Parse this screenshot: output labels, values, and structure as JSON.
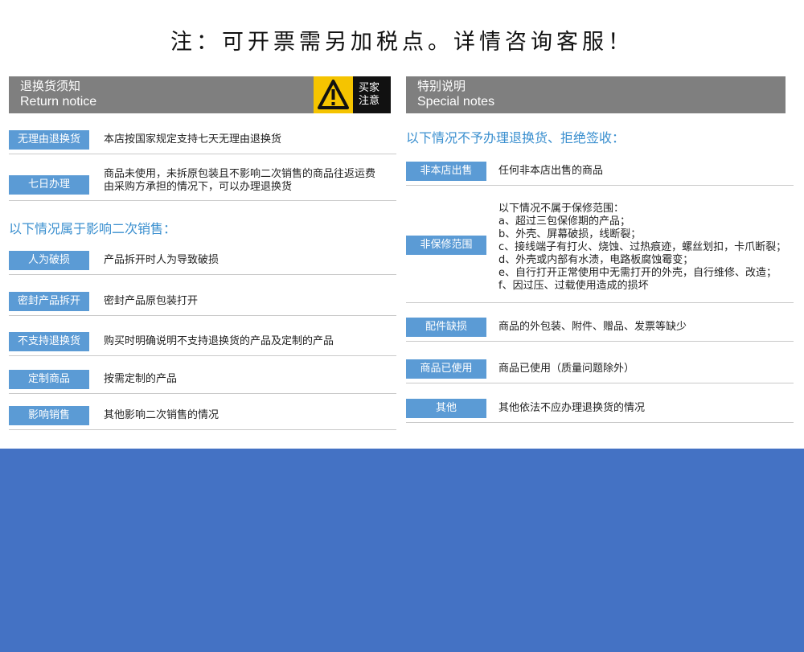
{
  "top_notice": "注：可开票需另加税点。详情咨询客服！",
  "left": {
    "header_cn": "退换货须知",
    "header_en": "Return notice",
    "warning_line1": "买家",
    "warning_line2": "注意",
    "rows_top": [
      {
        "tag": "无理由退换货",
        "lines": [
          "本店按国家规定支持七天无理由退换货"
        ]
      },
      {
        "tag": "七日办理",
        "lines": [
          "商品未使用，未拆原包装且不影响二次销售的商品往返运费",
          "由采购方承担的情况下，可以办理退换货"
        ]
      }
    ],
    "subheading": "以下情况属于影响二次销售：",
    "rows_bottom": [
      {
        "tag": "人为破损",
        "lines": [
          "产品拆开时人为导致破损"
        ]
      },
      {
        "tag": "密封产品拆开",
        "lines": [
          "密封产品原包装打开"
        ]
      },
      {
        "tag": "不支持退换货",
        "lines": [
          "购买时明确说明不支持退换货的产品及定制的产品"
        ]
      },
      {
        "tag": "定制商品",
        "lines": [
          "按需定制的产品"
        ]
      },
      {
        "tag": "影响销售",
        "lines": [
          "其他影响二次销售的情况"
        ]
      }
    ]
  },
  "right": {
    "header_cn": "特别说明",
    "header_en": "Special notes",
    "subheading": "以下情况不予办理退换货、拒绝签收：",
    "rows": [
      {
        "tag": "非本店出售",
        "lines": [
          "任何非本店出售的商品"
        ]
      },
      {
        "tag": "非保修范围",
        "lines": [
          "以下情况不属于保修范围：",
          "a、超过三包保修期的产品；",
          "b、外壳、屏幕破损，线断裂；",
          "c、接线端子有打火、烧蚀、过热痕迹，螺丝划扣，卡爪断裂；",
          "d、外壳或内部有水渍，电路板腐蚀霉变；",
          "e、自行打开正常使用中无需打开的外壳，自行维修、改造；",
          "f、因过压、过载使用造成的损坏"
        ]
      },
      {
        "tag": "配件缺损",
        "lines": [
          "商品的外包装、附件、赠品、发票等缺少"
        ]
      },
      {
        "tag": "商品已使用",
        "lines": [
          "商品已使用（质量问题除外）"
        ]
      },
      {
        "tag": "其他",
        "lines": [
          "其他依法不应办理退换货的情况"
        ]
      }
    ]
  },
  "colors": {
    "tag_blue": "#5b9bd5",
    "header_gray": "#7f7f7f",
    "subheading_blue": "#3a8fcf",
    "bottom_blue": "#4472c4",
    "warning_yellow": "#f5c400"
  }
}
